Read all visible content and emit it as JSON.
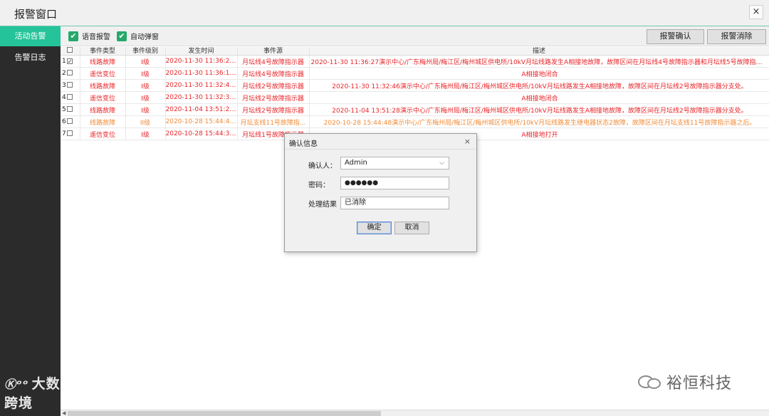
{
  "window": {
    "title": "报警窗口",
    "close_glyph": "×"
  },
  "sidebar": {
    "items": [
      {
        "label": "活动告警",
        "active": true
      },
      {
        "label": "告警日志",
        "active": false
      }
    ],
    "watermark_mark": "Ⓚᵒᵒ",
    "watermark_text": "大数跨境"
  },
  "toolbar": {
    "voice_alarm": {
      "label": "语音报警",
      "checked": true
    },
    "auto_popup": {
      "label": "自动弹窗",
      "checked": true
    },
    "confirm_button": "报警确认",
    "clear_button": "报警消除"
  },
  "table": {
    "columns": [
      "",
      "事件类型",
      "事件级别",
      "发生时间",
      "事件源",
      "描述"
    ],
    "rows": [
      {
        "num": "1",
        "checked": true,
        "type": "线路故障",
        "level": "I级",
        "time": "2020-11-30 11:36:27...",
        "source": "月坛线4号故障指示器",
        "desc": "2020-11-30 11:36:27演示中心/广东梅州局/梅江区/梅州城区供电所/10kV月坛线路发生A相接地故障，故障区间在月坛线4号故障指示器和月坛线5号故障指示器之间。",
        "color": "red",
        "desc_align": "left"
      },
      {
        "num": "2",
        "checked": false,
        "type": "遥信变位",
        "level": "I级",
        "time": "2020-11-30 11:36:17...",
        "source": "月坛线4号故障指示器",
        "desc": "A相接地闭合",
        "color": "red",
        "desc_align": "center"
      },
      {
        "num": "3",
        "checked": false,
        "type": "线路故障",
        "level": "I级",
        "time": "2020-11-30 11:32:46...",
        "source": "月坛线2号故障指示器",
        "desc": "2020-11-30 11:32:46演示中心/广东梅州局/梅江区/梅州城区供电所/10kV月坛线路发生A相接地故障，故障区间在月坛线2号故障指示器分支处。",
        "color": "red",
        "desc_align": "center"
      },
      {
        "num": "4",
        "checked": false,
        "type": "遥信变位",
        "level": "I级",
        "time": "2020-11-30 11:32:36...",
        "source": "月坛线2号故障指示器",
        "desc": "A相接地闭合",
        "color": "red",
        "desc_align": "center"
      },
      {
        "num": "5",
        "checked": false,
        "type": "线路故障",
        "level": "I级",
        "time": "2020-11-04 13:51:28...",
        "source": "月坛线2号故障指示器",
        "desc": "2020-11-04 13:51:28演示中心/广东梅州局/梅江区/梅州城区供电所/10kV月坛线路发生A相接地故障，故障区间在月坛线2号故障指示器分支处。",
        "color": "red",
        "desc_align": "center"
      },
      {
        "num": "6",
        "checked": false,
        "type": "线路故障",
        "level": "II级",
        "time": "2020-10-28 15:44:48...",
        "source": "月坛支线11号故障指...",
        "desc": "2020-10-28 15:44:48演示中心/广东梅州局/梅江区/梅州城区供电所/10kV月坛线路发生继电器状态2故障，故障区间在月坛支线11号故障指示器之后。",
        "color": "orange",
        "desc_align": "center"
      },
      {
        "num": "7",
        "checked": false,
        "type": "遥信变位",
        "level": "I级",
        "time": "2020-10-28 15:44:38...",
        "source": "月坛线1号故障指示器",
        "desc": "A相接地打开",
        "color": "red",
        "desc_align": "center"
      }
    ]
  },
  "dialog": {
    "title": "确认信息",
    "close_glyph": "×",
    "confirmer_label": "确认人：",
    "confirmer_value": "Admin",
    "password_label": "密码：",
    "password_value": "●●●●●●",
    "result_label": "处理结果",
    "result_value": "已消除",
    "ok_button": "确定",
    "cancel_button": "取消"
  },
  "brand": {
    "name": "裕恒科技"
  }
}
